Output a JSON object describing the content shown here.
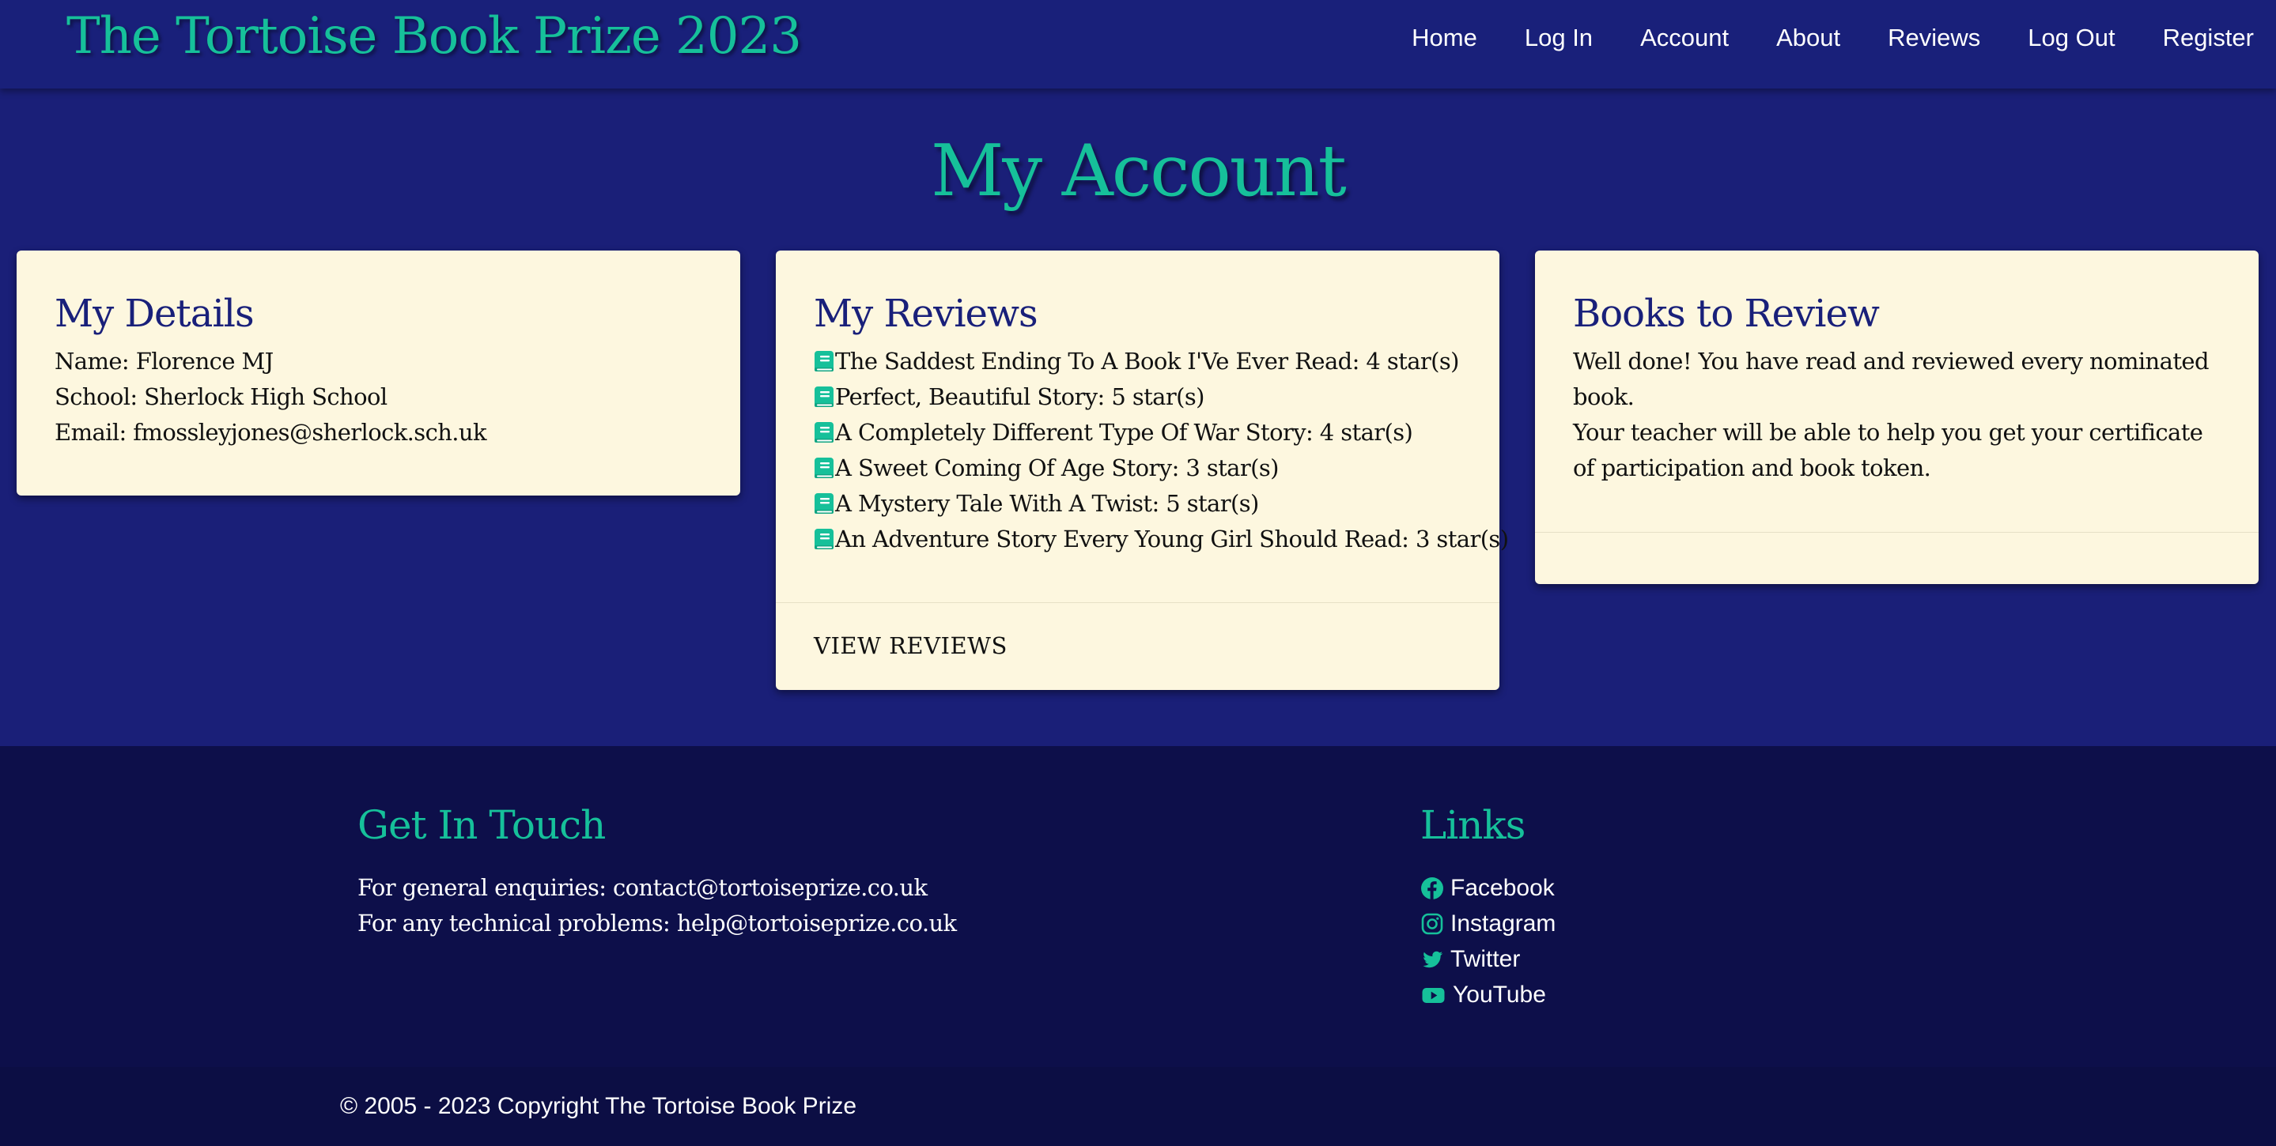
{
  "site": {
    "title": "The Tortoise Book Prize 2023"
  },
  "nav": {
    "items": [
      {
        "label": "Home"
      },
      {
        "label": "Log In"
      },
      {
        "label": "Account"
      },
      {
        "label": "About"
      },
      {
        "label": "Reviews"
      },
      {
        "label": "Log Out"
      },
      {
        "label": "Register"
      }
    ]
  },
  "page": {
    "title": "My Account"
  },
  "details": {
    "title": "My Details",
    "name": "Name: Florence MJ",
    "school": "School: Sherlock High School",
    "email": "Email: fmossleyjones@sherlock.sch.uk"
  },
  "reviews": {
    "title": "My Reviews",
    "items": [
      {
        "text": "The Saddest Ending To A Book I'Ve Ever Read: 4 star(s)",
        "icon": "book-icon"
      },
      {
        "text": "Perfect, Beautiful Story: 5 star(s)",
        "icon": "book-icon"
      },
      {
        "text": "A Completely Different Type Of War Story: 4 star(s)",
        "icon": "book-icon"
      },
      {
        "text": "A Sweet Coming Of Age Story: 3 star(s)",
        "icon": "book-icon"
      },
      {
        "text": "A Mystery Tale With A Twist: 5 star(s)",
        "icon": "book-icon"
      },
      {
        "text": "An Adventure Story Every Young Girl Should Read: 3 star(s)",
        "icon": "book-icon"
      }
    ],
    "view_label": "VIEW REVIEWS"
  },
  "to_review": {
    "title": "Books to Review",
    "message1": "Well done! You have read and reviewed every nominated book.",
    "message2": "Your teacher will be able to help you get your certificate of participation and book token."
  },
  "footer": {
    "contact": {
      "title": "Get In Touch",
      "general": "For general enquiries: contact@tortoiseprize.co.uk",
      "technical": "For any technical problems: help@tortoiseprize.co.uk"
    },
    "links": {
      "title": "Links",
      "items": [
        {
          "label": "Facebook",
          "icon": "facebook-icon"
        },
        {
          "label": "Instagram",
          "icon": "instagram-icon"
        },
        {
          "label": "Twitter",
          "icon": "twitter-icon"
        },
        {
          "label": "YouTube",
          "icon": "youtube-icon"
        }
      ]
    },
    "copyright": "© 2005 - 2023 Copyright The Tortoise Book Prize"
  },
  "colors": {
    "background": "#1a1f78",
    "navbar": "#19207a",
    "accent": "#16c09a",
    "card": "#fdf7df",
    "card_title": "#19207a",
    "footer": "#0d0f4a"
  }
}
